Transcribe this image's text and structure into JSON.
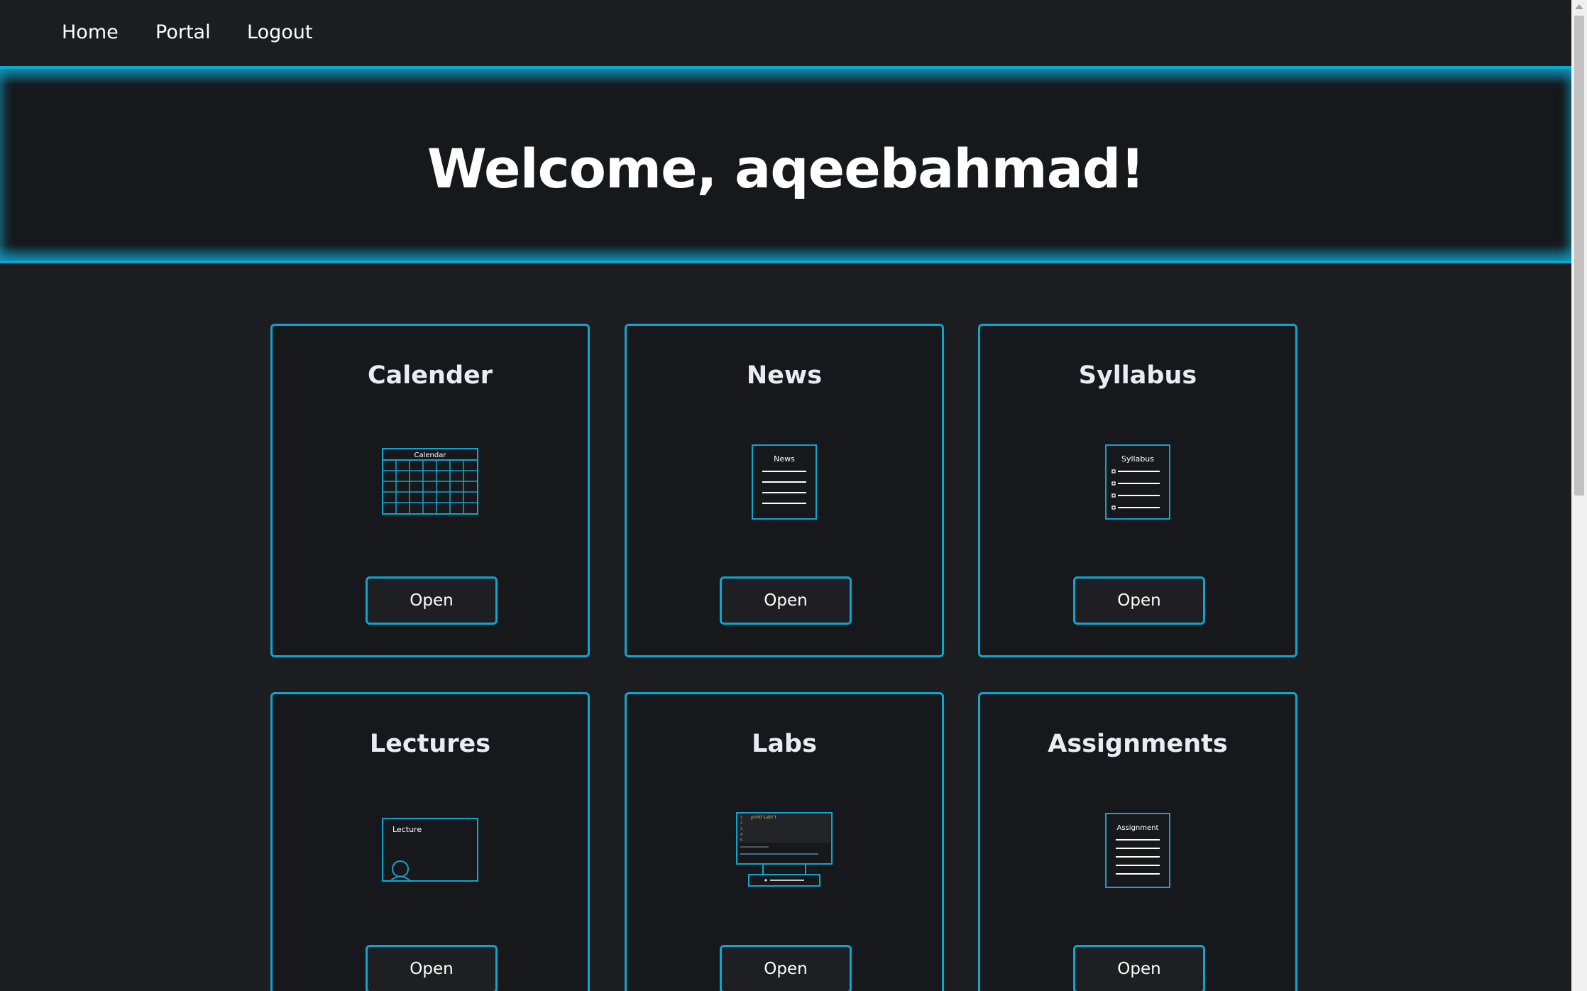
{
  "nav": {
    "home": "Home",
    "portal": "Portal",
    "logout": "Logout"
  },
  "hero": {
    "title": "Welcome, aqeebahmad!"
  },
  "cards": [
    {
      "title": "Calender",
      "icon_label": "Calendar",
      "icon": "calendar-icon",
      "button": "Open"
    },
    {
      "title": "News",
      "icon_label": "News",
      "icon": "news-icon",
      "button": "Open"
    },
    {
      "title": "Syllabus",
      "icon_label": "Syllabus",
      "icon": "syllabus-icon",
      "button": "Open"
    },
    {
      "title": "Lectures",
      "icon_label": "Lecture",
      "icon": "lecture-icon",
      "button": "Open"
    },
    {
      "title": "Labs",
      "icon_label": "print('Lab!')",
      "icon": "lab-monitor-icon",
      "button": "Open"
    },
    {
      "title": "Assignments",
      "icon_label": "Assignment",
      "icon": "assignment-icon",
      "button": "Open"
    }
  ],
  "colors": {
    "accent": "#0ea5cf",
    "background": "#1c1d20",
    "card_background": "#17181b"
  }
}
